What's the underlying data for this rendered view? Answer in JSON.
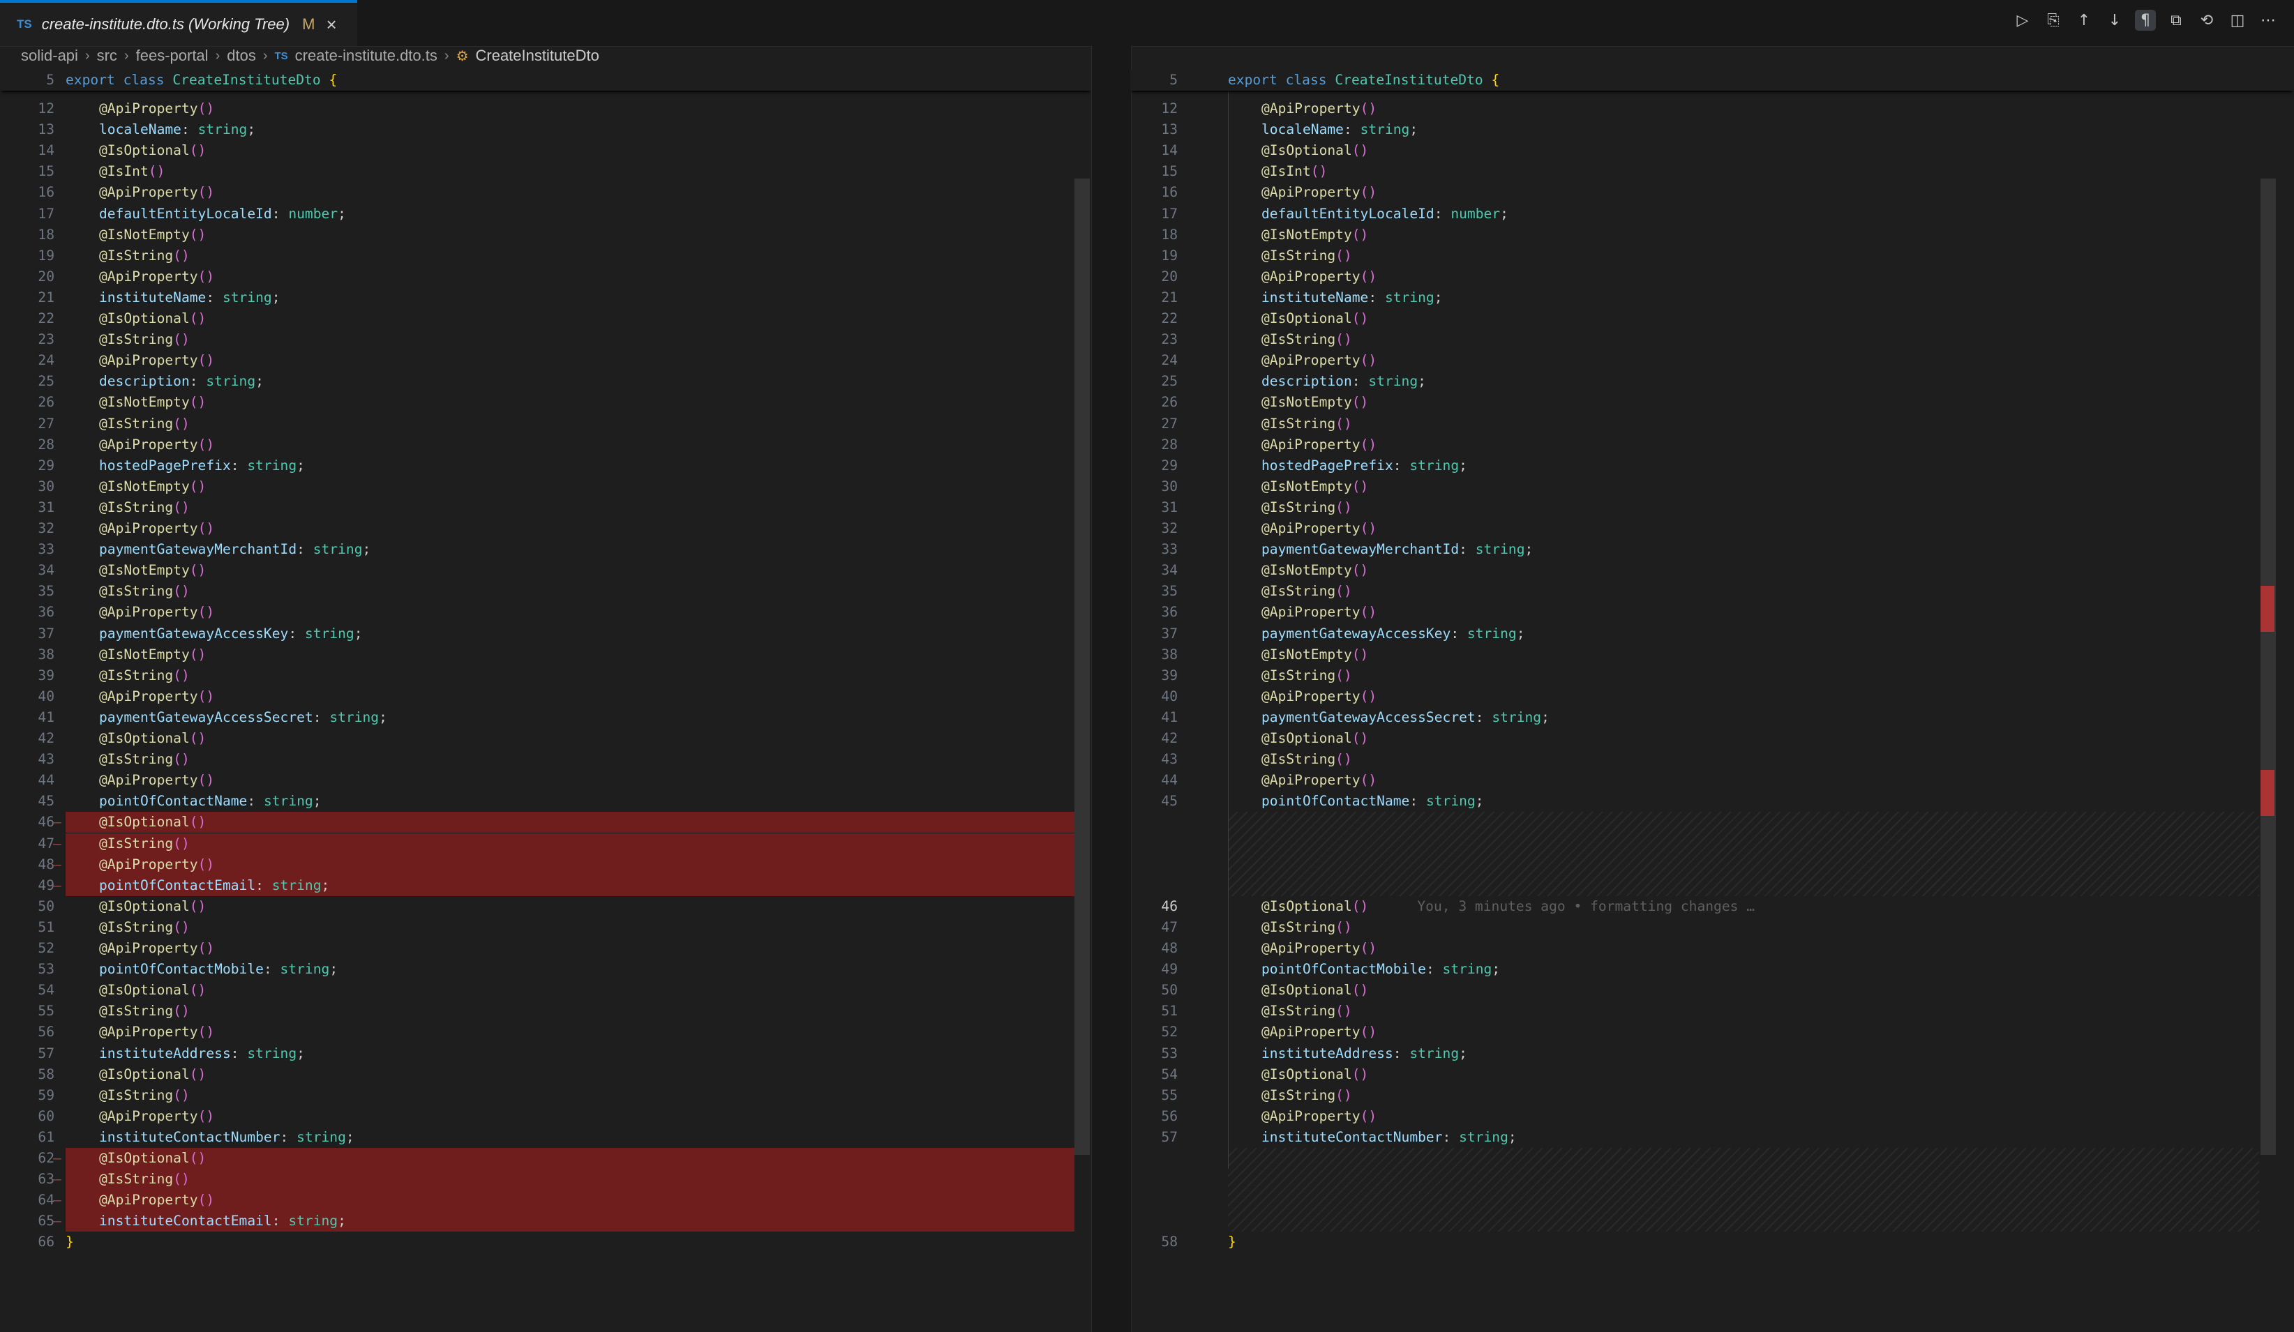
{
  "tab": {
    "lang_badge": "TS",
    "title": "create-institute.dto.ts (Working Tree)",
    "status": "M",
    "close": "×"
  },
  "toolbar": [
    {
      "name": "run-icon",
      "glyph": "▷",
      "active": false
    },
    {
      "name": "open-file-icon",
      "glyph": "⎘",
      "active": false
    },
    {
      "name": "previous-change-icon",
      "glyph": "↑",
      "active": false
    },
    {
      "name": "next-change-icon",
      "glyph": "↓",
      "active": false
    },
    {
      "name": "toggle-whitespace-icon",
      "glyph": "¶",
      "active": true
    },
    {
      "name": "inline-view-icon",
      "glyph": "⧉",
      "active": false
    },
    {
      "name": "revert-icon",
      "glyph": "⟲",
      "active": false
    },
    {
      "name": "split-editor-icon",
      "glyph": "◫",
      "active": false
    },
    {
      "name": "more-actions-icon",
      "glyph": "⋯",
      "active": false
    }
  ],
  "breadcrumb": {
    "items": [
      "solid-api",
      "src",
      "fees-portal",
      "dtos"
    ],
    "file_badge": "TS",
    "file": "create-institute.dto.ts",
    "symbol": "CreateInstituteDto"
  },
  "left": {
    "sticky": {
      "num": "5",
      "text": "export class CreateInstituteDto {"
    },
    "lines": [
      {
        "n": "12",
        "t": "@ApiProperty()"
      },
      {
        "n": "13",
        "t": "localeName: string;"
      },
      {
        "n": "14",
        "t": "@IsOptional()"
      },
      {
        "n": "15",
        "t": "@IsInt()"
      },
      {
        "n": "16",
        "t": "@ApiProperty()"
      },
      {
        "n": "17",
        "t": "defaultEntityLocaleId: number;"
      },
      {
        "n": "18",
        "t": "@IsNotEmpty()"
      },
      {
        "n": "19",
        "t": "@IsString()"
      },
      {
        "n": "20",
        "t": "@ApiProperty()"
      },
      {
        "n": "21",
        "t": "instituteName: string;"
      },
      {
        "n": "22",
        "t": "@IsOptional()"
      },
      {
        "n": "23",
        "t": "@IsString()"
      },
      {
        "n": "24",
        "t": "@ApiProperty()"
      },
      {
        "n": "25",
        "t": "description: string;"
      },
      {
        "n": "26",
        "t": "@IsNotEmpty()"
      },
      {
        "n": "27",
        "t": "@IsString()"
      },
      {
        "n": "28",
        "t": "@ApiProperty()"
      },
      {
        "n": "29",
        "t": "hostedPagePrefix: string;"
      },
      {
        "n": "30",
        "t": "@IsNotEmpty()"
      },
      {
        "n": "31",
        "t": "@IsString()"
      },
      {
        "n": "32",
        "t": "@ApiProperty()"
      },
      {
        "n": "33",
        "t": "paymentGatewayMerchantId: string;"
      },
      {
        "n": "34",
        "t": "@IsNotEmpty()"
      },
      {
        "n": "35",
        "t": "@IsString()"
      },
      {
        "n": "36",
        "t": "@ApiProperty()"
      },
      {
        "n": "37",
        "t": "paymentGatewayAccessKey: string;"
      },
      {
        "n": "38",
        "t": "@IsNotEmpty()"
      },
      {
        "n": "39",
        "t": "@IsString()"
      },
      {
        "n": "40",
        "t": "@ApiProperty()"
      },
      {
        "n": "41",
        "t": "paymentGatewayAccessSecret: string;"
      },
      {
        "n": "42",
        "t": "@IsOptional()"
      },
      {
        "n": "43",
        "t": "@IsString()"
      },
      {
        "n": "44",
        "t": "@ApiProperty()"
      },
      {
        "n": "45",
        "t": "pointOfContactName: string;"
      },
      {
        "n": "46",
        "t": "@IsOptional()",
        "del": true
      },
      {
        "n": "47",
        "t": "@IsString()",
        "del": true
      },
      {
        "n": "48",
        "t": "@ApiProperty()",
        "del": true
      },
      {
        "n": "49",
        "t": "pointOfContactEmail: string;",
        "del": true
      },
      {
        "n": "50",
        "t": "@IsOptional()"
      },
      {
        "n": "51",
        "t": "@IsString()"
      },
      {
        "n": "52",
        "t": "@ApiProperty()"
      },
      {
        "n": "53",
        "t": "pointOfContactMobile: string;"
      },
      {
        "n": "54",
        "t": "@IsOptional()"
      },
      {
        "n": "55",
        "t": "@IsString()"
      },
      {
        "n": "56",
        "t": "@ApiProperty()"
      },
      {
        "n": "57",
        "t": "instituteAddress: string;"
      },
      {
        "n": "58",
        "t": "@IsOptional()"
      },
      {
        "n": "59",
        "t": "@IsString()"
      },
      {
        "n": "60",
        "t": "@ApiProperty()"
      },
      {
        "n": "61",
        "t": "instituteContactNumber: string;"
      },
      {
        "n": "62",
        "t": "@IsOptional()",
        "del": true
      },
      {
        "n": "63",
        "t": "@IsString()",
        "del": true
      },
      {
        "n": "64",
        "t": "@ApiProperty()",
        "del": true
      },
      {
        "n": "65",
        "t": "instituteContactEmail: string;",
        "del": true
      },
      {
        "n": "66",
        "t": "}",
        "top": true
      }
    ]
  },
  "right": {
    "sticky": {
      "num": "5",
      "text": "export class CreateInstituteDto {"
    },
    "lines": [
      {
        "n": "12",
        "t": "@ApiProperty()"
      },
      {
        "n": "13",
        "t": "localeName: string;"
      },
      {
        "n": "14",
        "t": "@IsOptional()"
      },
      {
        "n": "15",
        "t": "@IsInt()"
      },
      {
        "n": "16",
        "t": "@ApiProperty()"
      },
      {
        "n": "17",
        "t": "defaultEntityLocaleId: number;"
      },
      {
        "n": "18",
        "t": "@IsNotEmpty()"
      },
      {
        "n": "19",
        "t": "@IsString()"
      },
      {
        "n": "20",
        "t": "@ApiProperty()"
      },
      {
        "n": "21",
        "t": "instituteName: string;"
      },
      {
        "n": "22",
        "t": "@IsOptional()"
      },
      {
        "n": "23",
        "t": "@IsString()"
      },
      {
        "n": "24",
        "t": "@ApiProperty()"
      },
      {
        "n": "25",
        "t": "description: string;"
      },
      {
        "n": "26",
        "t": "@IsNotEmpty()"
      },
      {
        "n": "27",
        "t": "@IsString()"
      },
      {
        "n": "28",
        "t": "@ApiProperty()"
      },
      {
        "n": "29",
        "t": "hostedPagePrefix: string;"
      },
      {
        "n": "30",
        "t": "@IsNotEmpty()"
      },
      {
        "n": "31",
        "t": "@IsString()"
      },
      {
        "n": "32",
        "t": "@ApiProperty()"
      },
      {
        "n": "33",
        "t": "paymentGatewayMerchantId: string;"
      },
      {
        "n": "34",
        "t": "@IsNotEmpty()"
      },
      {
        "n": "35",
        "t": "@IsString()"
      },
      {
        "n": "36",
        "t": "@ApiProperty()"
      },
      {
        "n": "37",
        "t": "paymentGatewayAccessKey: string;"
      },
      {
        "n": "38",
        "t": "@IsNotEmpty()"
      },
      {
        "n": "39",
        "t": "@IsString()"
      },
      {
        "n": "40",
        "t": "@ApiProperty()"
      },
      {
        "n": "41",
        "t": "paymentGatewayAccessSecret: string;"
      },
      {
        "n": "42",
        "t": "@IsOptional()"
      },
      {
        "n": "43",
        "t": "@IsString()"
      },
      {
        "n": "44",
        "t": "@ApiProperty()"
      },
      {
        "n": "45",
        "t": "pointOfContactName: string;"
      },
      {
        "gap": 4
      },
      {
        "n": "46",
        "t": "@IsOptional()",
        "cur": true,
        "blame": "You, 3 minutes ago • formatting changes …"
      },
      {
        "n": "47",
        "t": "@IsString()"
      },
      {
        "n": "48",
        "t": "@ApiProperty()"
      },
      {
        "n": "49",
        "t": "pointOfContactMobile: string;"
      },
      {
        "n": "50",
        "t": "@IsOptional()"
      },
      {
        "n": "51",
        "t": "@IsString()"
      },
      {
        "n": "52",
        "t": "@ApiProperty()"
      },
      {
        "n": "53",
        "t": "instituteAddress: string;"
      },
      {
        "n": "54",
        "t": "@IsOptional()"
      },
      {
        "n": "55",
        "t": "@IsString()"
      },
      {
        "n": "56",
        "t": "@ApiProperty()"
      },
      {
        "n": "57",
        "t": "instituteContactNumber: string;"
      },
      {
        "gap": 4
      },
      {
        "n": "58",
        "t": "}",
        "top": true
      }
    ]
  }
}
